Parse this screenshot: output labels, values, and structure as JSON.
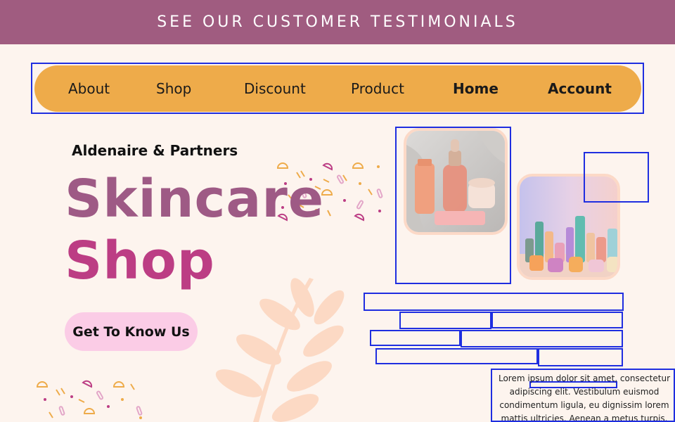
{
  "banner": {
    "text": "SEE OUR CUSTOMER TESTIMONIALS"
  },
  "nav": {
    "items": [
      {
        "label": "About"
      },
      {
        "label": "Shop"
      },
      {
        "label": "Discount"
      },
      {
        "label": "Product"
      },
      {
        "label": "Home"
      },
      {
        "label": "Account"
      }
    ]
  },
  "hero": {
    "brand": "Aldenaire & Partners",
    "title_line1": "Skincare",
    "title_line2": "Shop",
    "cta_label": "Get To Know Us"
  },
  "paragraph": {
    "lines": [
      "Lorem ipsum dolor sit amet, consectetur",
      "adipiscing elit. Vestibulum euismod",
      "condimentum ligula, eu dignissim lorem",
      "mattis ultricies. Aenean a metus turpis."
    ]
  },
  "colors": {
    "banner": "#a05c80",
    "nav": "#eeab4a",
    "title1": "#9e5a85",
    "title2": "#bc3d84",
    "cta": "#fbcce6",
    "background": "#fdf4ee",
    "annotation": "#1f2ee0"
  }
}
